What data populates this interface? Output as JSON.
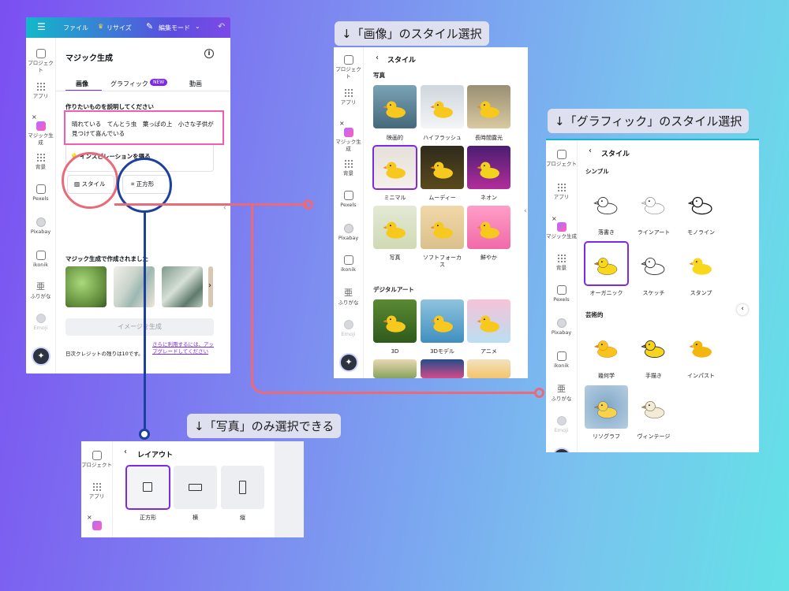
{
  "topbar": {
    "file": "ファイル",
    "resize": "リサイズ",
    "mode": "編集モード"
  },
  "rail_full": {
    "items": [
      "プロジェクト",
      "アプリ",
      "マジック生成",
      "背景",
      "Pexels",
      "Pixabay",
      "ikonik",
      "ふりがな",
      "Emoji"
    ]
  },
  "main": {
    "title": "マジック生成",
    "tabs": [
      "画像",
      "グラフィック",
      "動画"
    ],
    "badge": "NEW",
    "prompt_label": "作りたいものを説明してください",
    "prompt_text": "晴れている　てんとう虫　葉っぱの上　小さな子供が見つけて喜んでいる",
    "inspire": "インスピレーションを得る",
    "style_btn": "スタイル",
    "ratio_btn": "正方形",
    "created_label": "マジック生成で作成されました",
    "generate": "イメージを生成",
    "credits": "日次クレジットの残りは10です。",
    "upgrade": "さらに利用するには、アップグレードしてください"
  },
  "labels": {
    "image_style": "↓「画像」のスタイル選択",
    "graphic_style": "↓「グラフィック」のスタイル選択",
    "photo_only": "↓「写真」のみ選択できる"
  },
  "image_panel": {
    "header": "スタイル",
    "section_photo": "写真",
    "section_digital": "デジタルアート",
    "photo_styles": [
      "映画的",
      "ハイフラッシュ",
      "長時間露光",
      "ミニマル",
      "ムーディー",
      "ネオン",
      "写真",
      "ソフトフォーカス",
      "鮮やか"
    ],
    "digital_styles": [
      "3D",
      "3Dモデル",
      "アニメ"
    ],
    "rail": [
      "プロジェクト",
      "アプリ",
      "マジック生成",
      "背景",
      "Pexels",
      "Pixabay",
      "ikonik",
      "ふりがな",
      "Emoji"
    ]
  },
  "graphic_panel": {
    "header": "スタイル",
    "section_simple": "シンプル",
    "section_art": "芸術的",
    "simple_styles": [
      "落書き",
      "ラインアート",
      "モノライン",
      "オーガニック",
      "スケッチ",
      "スタンプ"
    ],
    "art_styles": [
      "幾何学",
      "手描き",
      "インパスト",
      "リソグラフ",
      "ヴィンテージ"
    ],
    "rail": [
      "プロジェクト",
      "アプリ",
      "マジック生成",
      "背景",
      "Pexels",
      "Pixabay",
      "ikonik",
      "ふりがな",
      "Emoji"
    ]
  },
  "layout_panel": {
    "header": "レイアウト",
    "options": [
      "正方形",
      "横",
      "縦"
    ],
    "rail": [
      "プロジェクト",
      "アプリ"
    ]
  },
  "colors": {
    "accent": "#7d2ae8",
    "pink": "#e96a7a",
    "blue": "#1d3f9e",
    "highlight": "#f25cb2"
  }
}
